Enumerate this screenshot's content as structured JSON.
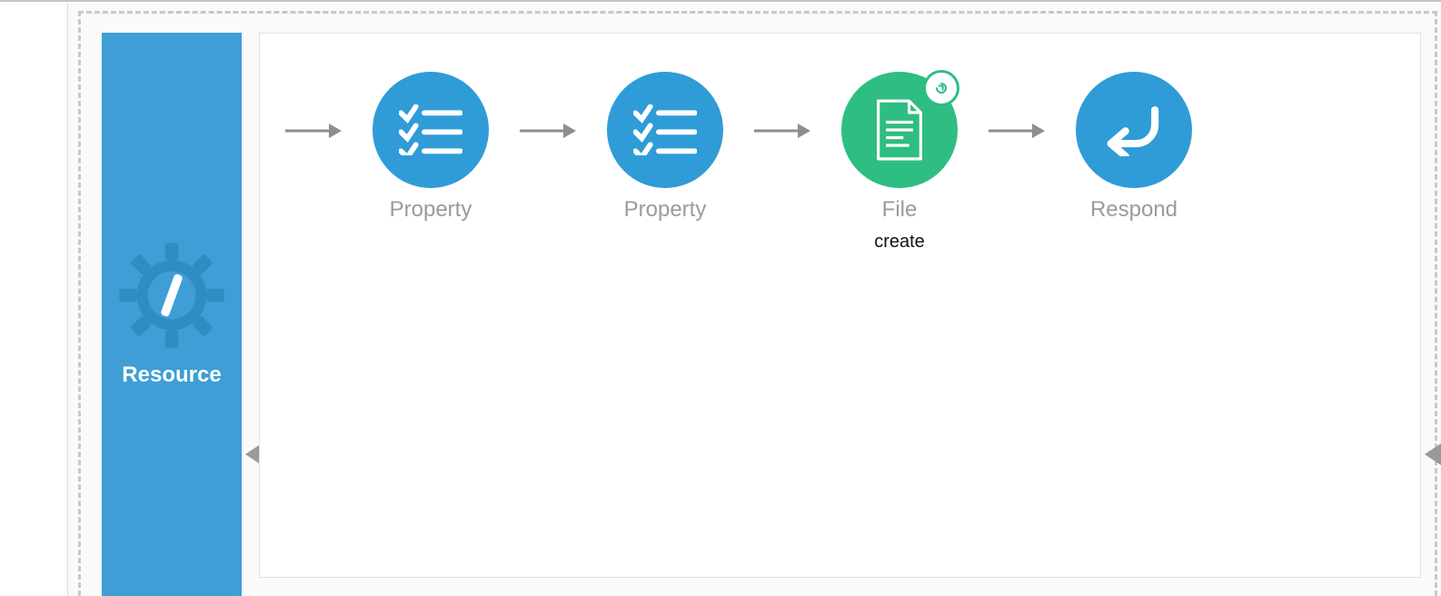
{
  "sidebar": {
    "label": "Resource",
    "icon": "gear-service-icon"
  },
  "flow": {
    "nodes": [
      {
        "label": "Property",
        "sublabel": "",
        "type": "property",
        "badge": false
      },
      {
        "label": "Property",
        "sublabel": "",
        "type": "property",
        "badge": false
      },
      {
        "label": "File",
        "sublabel": "create",
        "type": "file",
        "badge": true
      },
      {
        "label": "Respond",
        "sublabel": "",
        "type": "respond",
        "badge": false
      }
    ]
  },
  "colors": {
    "blue": "#2f9cd7",
    "green": "#2ebd83",
    "sidebar": "#3e9ed5",
    "muted_text": "#9b9b9b"
  }
}
